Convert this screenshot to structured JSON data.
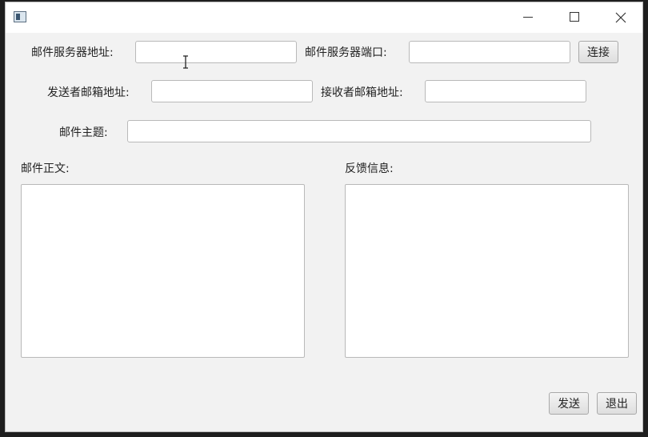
{
  "window": {
    "icon": "app-window-icon",
    "controls": {
      "minimize": "minimize-icon",
      "maximize": "maximize-icon",
      "close": "close-icon"
    }
  },
  "form": {
    "server_address_label": "邮件服务器地址:",
    "server_address_value": "",
    "server_port_label": "邮件服务器端口:",
    "server_port_value": "",
    "connect_button": "连接",
    "sender_label": "发送者邮箱地址:",
    "sender_value": "",
    "receiver_label": "接收者邮箱地址:",
    "receiver_value": "",
    "subject_label": "邮件主题:",
    "subject_value": ""
  },
  "body_panel": {
    "label": "邮件正文:",
    "value": ""
  },
  "feedback_panel": {
    "label": "反馈信息:",
    "value": ""
  },
  "actions": {
    "send_button": "发送",
    "exit_button": "退出"
  },
  "mouse_cursor": "text-cursor-icon"
}
